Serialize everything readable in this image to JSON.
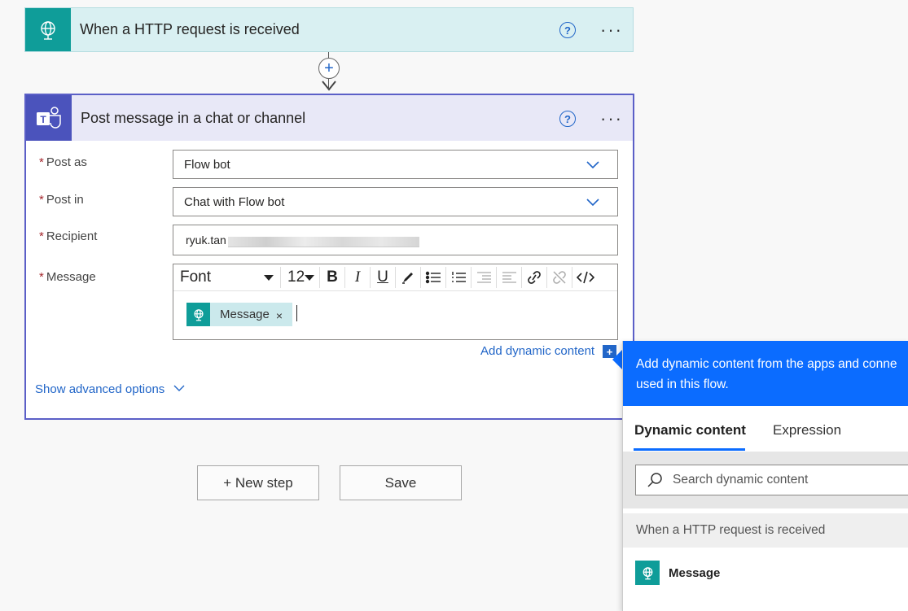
{
  "trigger": {
    "title": "When a HTTP request is received",
    "help_icon": "question-circle-icon",
    "more_icon": "ellipsis-icon"
  },
  "connector": {
    "add_symbol": "+"
  },
  "action": {
    "title": "Post message in a chat or channel",
    "fields": {
      "post_as": {
        "label": "Post as",
        "value": "Flow bot"
      },
      "post_in": {
        "label": "Post in",
        "value": "Chat with Flow bot"
      },
      "recipient": {
        "label": "Recipient",
        "value": "ryuk.tan"
      },
      "message": {
        "label": "Message"
      }
    },
    "required_marker": "*",
    "toolbar": {
      "font": "Font",
      "size": "12",
      "bold": "B",
      "italic": "I",
      "underline": "U"
    },
    "token": {
      "label": "Message",
      "remove": "×"
    },
    "add_dynamic_content": "Add dynamic content",
    "add_dynamic_icon": "+",
    "show_advanced": "Show advanced options"
  },
  "buttons": {
    "new_step": "+ New step",
    "save": "Save"
  },
  "dynamic_panel": {
    "header_line1": "Add dynamic content from the apps and conne",
    "header_line2": "used in this flow.",
    "tabs": {
      "dynamic": "Dynamic content",
      "expression": "Expression"
    },
    "search_placeholder": "Search dynamic content",
    "section": "When a HTTP request is received",
    "item": "Message"
  },
  "colors": {
    "trigger_accent": "#0f9d99",
    "teams_accent": "#4b53bc",
    "link_blue": "#2266c8",
    "panel_blue": "#0b6cff"
  }
}
